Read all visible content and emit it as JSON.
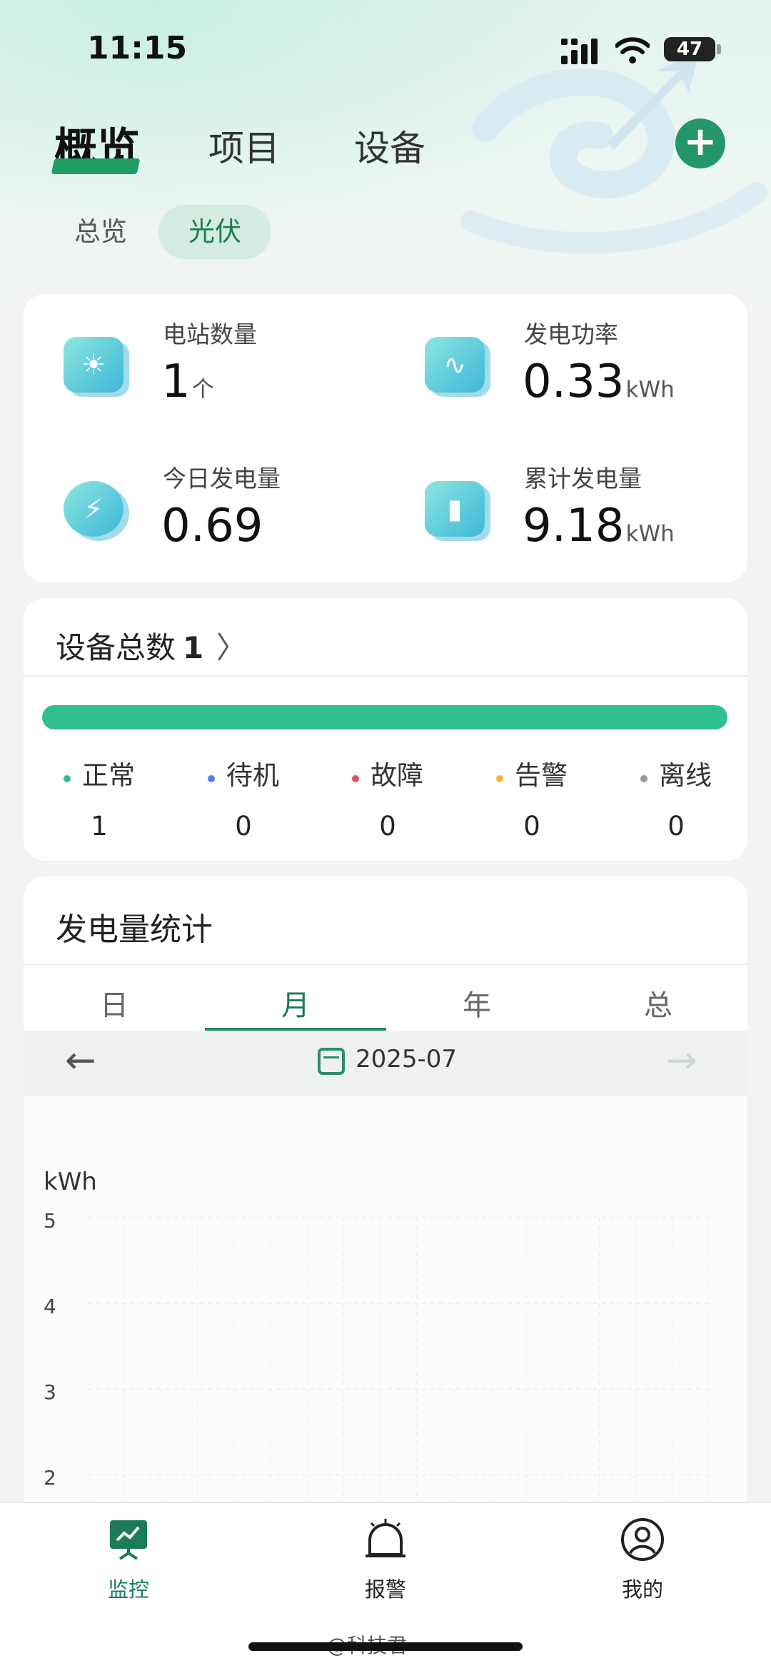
{
  "status_bar": {
    "time": "11:15",
    "battery": "47"
  },
  "header": {
    "tabs": [
      {
        "label": "概览"
      },
      {
        "label": "项目"
      },
      {
        "label": "设备"
      }
    ],
    "subtabs": [
      {
        "label": "总览"
      },
      {
        "label": "光伏"
      }
    ]
  },
  "stats": [
    {
      "label": "电站数量",
      "value": "1",
      "unit": "个",
      "icon": "solar-panel-icon"
    },
    {
      "label": "发电功率",
      "value": "0.33",
      "unit": "kWh",
      "icon": "pulse-icon"
    },
    {
      "label": "今日发电量",
      "value": "0.69",
      "unit": "",
      "icon": "lightning-icon"
    },
    {
      "label": "累计发电量",
      "value": "9.18",
      "unit": "kWh",
      "icon": "bar-chart-icon"
    }
  ],
  "devices": {
    "title": "设备总数",
    "total": "1",
    "statuses": [
      {
        "label": "正常",
        "count": "1",
        "color": "#2fc08e"
      },
      {
        "label": "待机",
        "count": "0",
        "color": "#4f7fe6"
      },
      {
        "label": "故障",
        "count": "0",
        "color": "#e8505b"
      },
      {
        "label": "告警",
        "count": "0",
        "color": "#f2b530"
      },
      {
        "label": "离线",
        "count": "0",
        "color": "#8e9a9e"
      }
    ]
  },
  "generation": {
    "title": "发电量统计",
    "periods": [
      {
        "label": "日"
      },
      {
        "label": "月"
      },
      {
        "label": "年"
      },
      {
        "label": "总"
      }
    ],
    "active_period": "月",
    "date": "2025-07"
  },
  "chart_data": {
    "type": "bar",
    "ylabel": "kWh",
    "y_ticks": [
      "5",
      "4",
      "3",
      "2"
    ],
    "ylim": [
      0,
      5
    ],
    "grid": true,
    "categories": [],
    "values": []
  },
  "bottom_nav": [
    {
      "label": "监控",
      "icon": "monitor-icon"
    },
    {
      "label": "报警",
      "icon": "alarm-bell-icon"
    },
    {
      "label": "我的",
      "icon": "user-icon"
    }
  ],
  "watermark": "@科技君",
  "colors": {
    "accent": "#1f9d63",
    "progress": "#2fc08e"
  }
}
